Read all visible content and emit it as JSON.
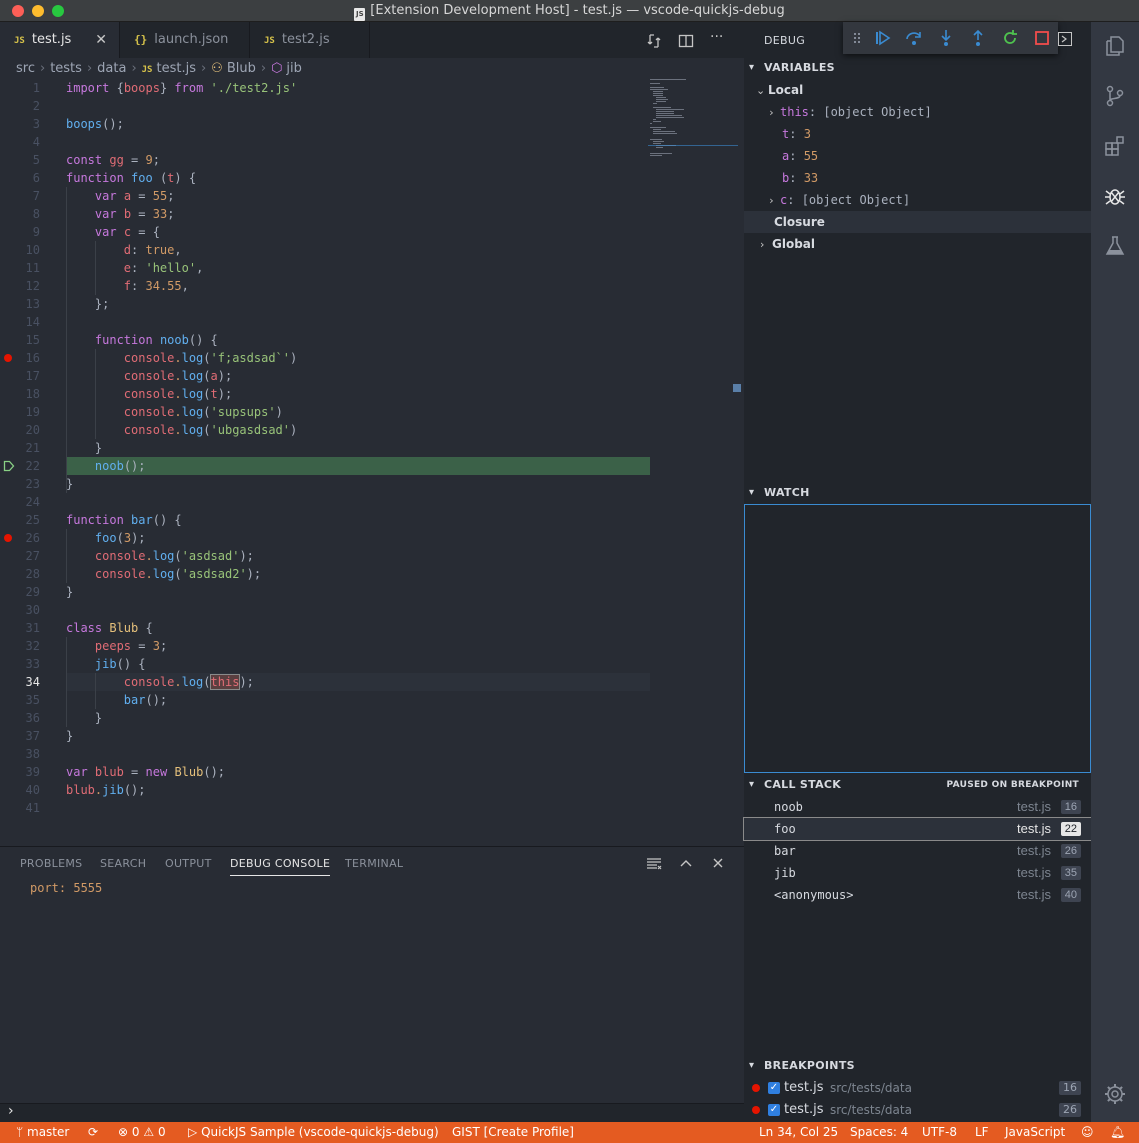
{
  "window": {
    "title": "[Extension Development Host] - test.js — vscode-quickjs-debug"
  },
  "tabs": [
    {
      "label": "test.js",
      "icon": "JS",
      "active": true
    },
    {
      "label": "launch.json",
      "icon": "{}",
      "active": false
    },
    {
      "label": "test2.js",
      "icon": "JS",
      "active": false
    }
  ],
  "breadcrumb": [
    "src",
    "tests",
    "data",
    "test.js",
    "Blub",
    "jib"
  ],
  "editor": {
    "current_line": 34,
    "paused_line": 22,
    "breakpoint_lines": [
      16,
      26
    ],
    "lines": [
      "import {boops} from './test2.js'",
      "",
      "boops();",
      "",
      "const gg = 9;",
      "function foo (t) {",
      "    var a = 55;",
      "    var b = 33;",
      "    var c = {",
      "        d: true,",
      "        e: 'hello',",
      "        f: 34.55,",
      "    };",
      "",
      "    function noob() {",
      "        console.log('f;asdsad`')",
      "        console.log(a);",
      "        console.log(t);",
      "        console.log('supsups')",
      "        console.log('ubgasdsad')",
      "    }",
      "    noob();",
      "}",
      "",
      "function bar() {",
      "    foo(3);",
      "    console.log('asdsad');",
      "    console.log('asdsad2');",
      "}",
      "",
      "class Blub {",
      "    peeps = 3;",
      "    jib() {",
      "        console.log(this);",
      "        bar();",
      "    }",
      "}",
      "",
      "var blub = new Blub();",
      "blub.jib();",
      ""
    ]
  },
  "panel": {
    "tabs": [
      "PROBLEMS",
      "SEARCH",
      "OUTPUT",
      "DEBUG CONSOLE",
      "TERMINAL"
    ],
    "active_tab": "DEBUG CONSOLE",
    "console_output": "port: 5555",
    "prompt": "›"
  },
  "debug": {
    "header": "DEBUG",
    "variables_header": "VARIABLES",
    "scopes": {
      "local": "Local",
      "closure": "Closure",
      "global": "Global"
    },
    "locals": [
      {
        "name": "this",
        "value": "[object Object]",
        "expandable": true
      },
      {
        "name": "t",
        "value": "3",
        "expandable": false
      },
      {
        "name": "a",
        "value": "55",
        "expandable": false
      },
      {
        "name": "b",
        "value": "33",
        "expandable": false
      },
      {
        "name": "c",
        "value": "[object Object]",
        "expandable": true
      }
    ],
    "watch_header": "WATCH",
    "callstack_header": "CALL STACK",
    "callstack_status": "PAUSED ON BREAKPOINT",
    "callstack": [
      {
        "fn": "noob",
        "file": "test.js",
        "line": "16"
      },
      {
        "fn": "foo",
        "file": "test.js",
        "line": "22"
      },
      {
        "fn": "bar",
        "file": "test.js",
        "line": "26"
      },
      {
        "fn": "jib",
        "file": "test.js",
        "line": "35"
      },
      {
        "fn": "<anonymous>",
        "file": "test.js",
        "line": "40"
      }
    ],
    "breakpoints_header": "BREAKPOINTS",
    "breakpoints": [
      {
        "file": "test.js",
        "path": "src/tests/data",
        "line": "16"
      },
      {
        "file": "test.js",
        "path": "src/tests/data",
        "line": "26"
      }
    ]
  },
  "statusbar": {
    "branch": "master",
    "errors": "0",
    "warnings": "0",
    "launch": "QuickJS Sample (vscode-quickjs-debug)",
    "gist": "GIST [Create Profile]",
    "position": "Ln 34, Col 25",
    "spaces": "Spaces: 4",
    "encoding": "UTF-8",
    "eol": "LF",
    "language": "JavaScript"
  },
  "colors": {
    "statusbar": "#e45b21",
    "accent": "#3a8bd1",
    "breakpoint": "#e51400",
    "paused_line": "#3b6148"
  }
}
